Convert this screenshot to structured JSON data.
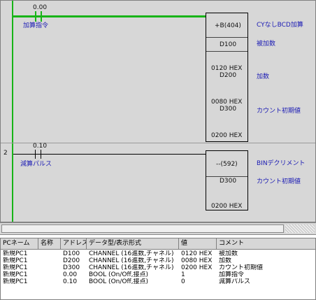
{
  "rung1": {
    "contact_addr": "0.00",
    "contact_comment": "加算指令",
    "instruction": "+B(404)",
    "instruction_comment": "CYなしBCD加算",
    "op1_addr": "D100",
    "op1_comment": "被加数",
    "op2_value": "0120 HEX",
    "op2_addr": "D200",
    "op2_comment": "加数",
    "op3_value": "0080 HEX",
    "op3_addr": "D300",
    "op3_comment": "カウント初期値",
    "op3_result": "0200 HEX"
  },
  "rung2": {
    "rung_number": "2",
    "contact_addr": "0.10",
    "contact_comment": "減算パルス",
    "instruction": "--(592)",
    "instruction_comment": "BINデクリメント",
    "op1_addr": "D300",
    "op1_comment": "カウント初期値",
    "op1_value": "0200 HEX"
  },
  "table": {
    "headers": [
      "PCネーム",
      "名称",
      "アドレス",
      "データ型/表示形式",
      "値",
      "コメント"
    ],
    "rows": [
      [
        "新規PC1",
        "",
        "D100",
        "CHANNEL (16進数,チャネル)",
        "0120 HEX",
        "被加数"
      ],
      [
        "新規PC1",
        "",
        "D200",
        "CHANNEL (16進数,チャネル)",
        "0080 HEX",
        "加数"
      ],
      [
        "新規PC1",
        "",
        "D300",
        "CHANNEL (16進数,チャネル)",
        "0200 HEX",
        "カウント初期値"
      ],
      [
        "新規PC1",
        "",
        "0.00",
        "BOOL (On/Off,接点)",
        "1",
        "加算指令"
      ],
      [
        "新規PC1",
        "",
        "0.10",
        "BOOL (On/Off,接点)",
        "0",
        "減算パルス"
      ]
    ]
  },
  "colors": {
    "energized": "#18b418",
    "comment_text": "#1a1ab4",
    "panel": "#d7d7d7"
  }
}
